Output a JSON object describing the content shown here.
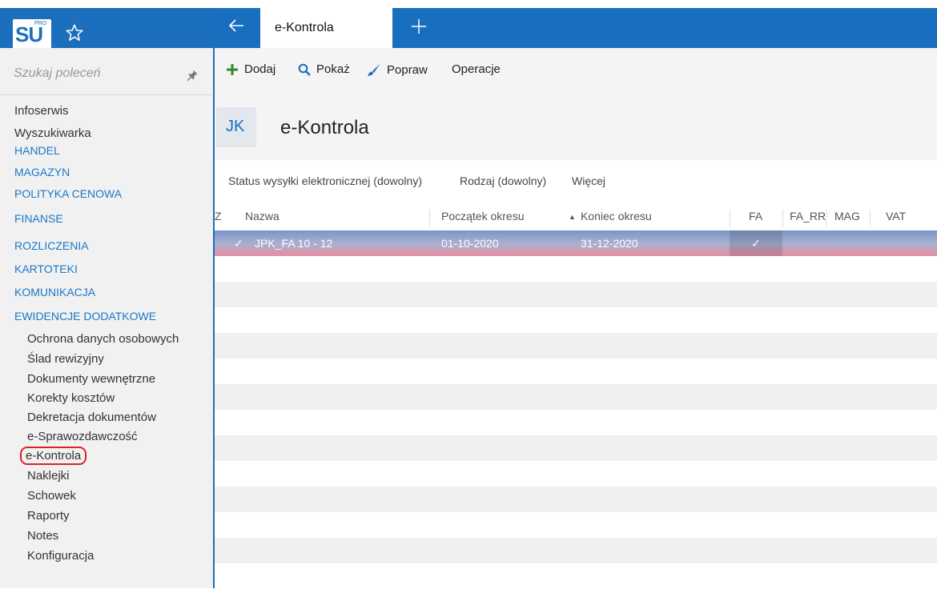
{
  "app": {
    "logo_main": "SU",
    "logo_sup": "PRO"
  },
  "tabs": [
    {
      "label": "e-Kontrola"
    }
  ],
  "sidebar": {
    "search_placeholder": "Szukaj poleceń",
    "items": [
      {
        "label": "Infoserwis",
        "kind": "top"
      },
      {
        "label": "Wyszukiwarka",
        "kind": "top"
      },
      {
        "label": "HANDEL",
        "kind": "section"
      },
      {
        "label": "MAGAZYN",
        "kind": "section"
      },
      {
        "label": "POLITYKA CENOWA",
        "kind": "section"
      },
      {
        "label": "FINANSE",
        "kind": "section"
      },
      {
        "label": "ROZLICZENIA",
        "kind": "section"
      },
      {
        "label": "KARTOTEKI",
        "kind": "section"
      },
      {
        "label": "KOMUNIKACJA",
        "kind": "section"
      },
      {
        "label": "EWIDENCJE DODATKOWE",
        "kind": "section"
      },
      {
        "label": "Ochrona danych osobowych",
        "kind": "sub"
      },
      {
        "label": "Ślad rewizyjny",
        "kind": "sub"
      },
      {
        "label": "Dokumenty wewnętrzne",
        "kind": "sub"
      },
      {
        "label": "Korekty kosztów",
        "kind": "sub"
      },
      {
        "label": "Dekretacja dokumentów",
        "kind": "sub"
      },
      {
        "label": "e-Sprawozdawczość",
        "kind": "sub"
      },
      {
        "label": "e-Kontrola",
        "kind": "sub",
        "selected": true
      },
      {
        "label": "Naklejki",
        "kind": "sub"
      },
      {
        "label": "Schowek",
        "kind": "sub"
      },
      {
        "label": "Raporty",
        "kind": "sub"
      },
      {
        "label": "Notes",
        "kind": "sub"
      },
      {
        "label": "Konfiguracja",
        "kind": "sub"
      }
    ]
  },
  "toolbar": {
    "add_label": "Dodaj",
    "show_label": "Pokaż",
    "edit_label": "Popraw",
    "operations_label": "Operacje"
  },
  "header": {
    "badge": "JK",
    "title": "e-Kontrola"
  },
  "filters": {
    "status": "Status wysyłki elektronicznej (dowolny)",
    "type": "Rodzaj (dowolny)",
    "more": "Więcej"
  },
  "grid": {
    "columns": [
      "Z",
      "Nazwa",
      "Początek okresu",
      "Koniec okresu",
      "FA",
      "FA_RR",
      "MAG",
      "VAT"
    ],
    "sort_indicator": "▲",
    "rows": [
      {
        "z": "✓",
        "nazwa": "JPK_FA 10 - 12",
        "poczatek": "01-10-2020",
        "koniec": "31-12-2020",
        "fa": "✓",
        "fa_rr": "",
        "mag": "",
        "vat": ""
      }
    ]
  },
  "colors": {
    "titlebar": "#1a6ec0",
    "section_text": "#1a78c8",
    "selection_outline": "#d9232b",
    "add_icon": "#2e8b2e",
    "show_icon": "#1a6ec0",
    "edit_icon": "#1a6ec0"
  }
}
